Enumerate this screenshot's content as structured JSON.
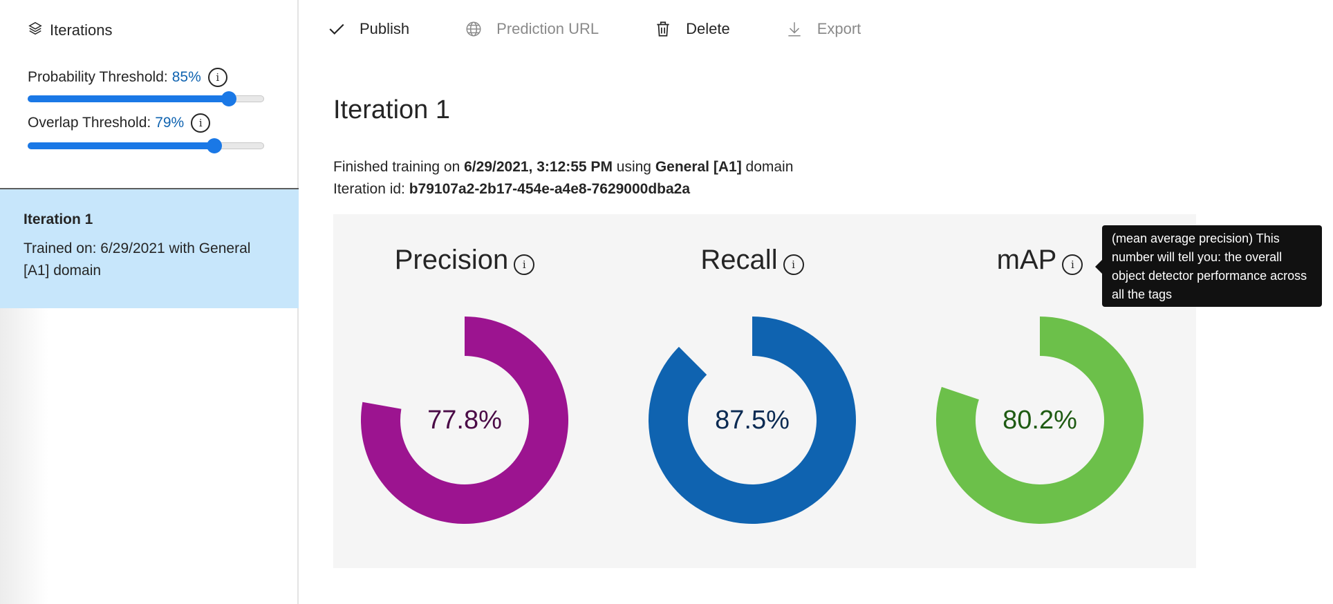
{
  "sidebar": {
    "header_label": "Iterations",
    "probability": {
      "label": "Probability Threshold:",
      "value": "85%",
      "fraction": 0.85
    },
    "overlap": {
      "label": "Overlap Threshold:",
      "value": "79%",
      "fraction": 0.79
    },
    "iteration": {
      "title": "Iteration 1",
      "description": "Trained on: 6/29/2021 with General [A1] domain"
    }
  },
  "toolbar": {
    "publish": "Publish",
    "prediction_url": "Prediction URL",
    "delete": "Delete",
    "export": "Export"
  },
  "main": {
    "title": "Iteration 1",
    "training_prefix": "Finished training on ",
    "training_date": "6/29/2021, 3:12:55 PM",
    "training_mid": " using ",
    "training_domain": "General [A1]",
    "training_suffix": " domain",
    "id_prefix": "Iteration id: ",
    "iteration_id": "b79107a2-2b17-454e-a4e8-7629000dba2a"
  },
  "metrics": [
    {
      "name": "Precision",
      "value": 77.8,
      "label": "77.8%",
      "color": "#9c1490",
      "text_color": "#4a0a46"
    },
    {
      "name": "Recall",
      "value": 87.5,
      "label": "87.5%",
      "color": "#0f63b0",
      "text_color": "#0a2a52"
    },
    {
      "name": "mAP",
      "value": 80.2,
      "label": "80.2%",
      "color": "#6cc04a",
      "text_color": "#1e5a12"
    }
  ],
  "tooltip": {
    "text": "(mean average precision) This number will tell you: the overall object detector performance across all the tags"
  }
}
